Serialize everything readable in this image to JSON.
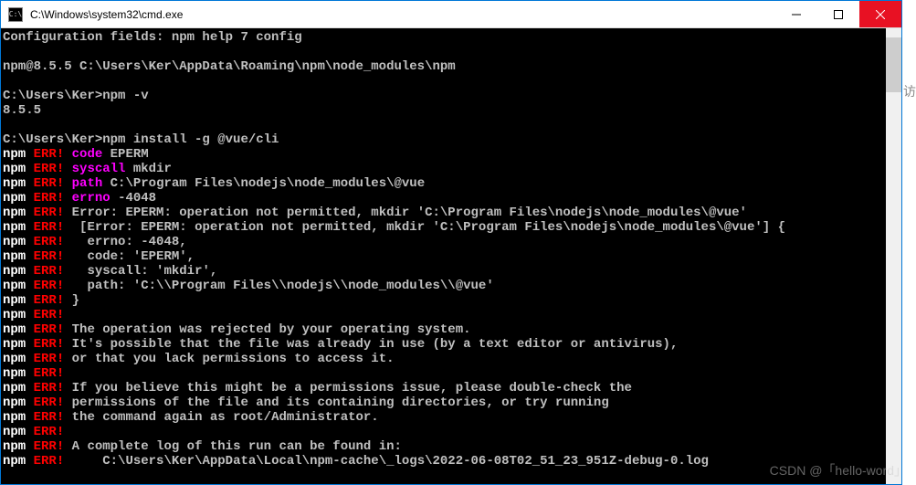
{
  "titlebar": {
    "icon_text": "C:\\",
    "title": "C:\\Windows\\system32\\cmd.exe"
  },
  "terminal": {
    "config_line": "Configuration fields: npm help 7 config",
    "npm_path": "npm@8.5.5 C:\\Users\\Ker\\AppData\\Roaming\\npm\\node_modules\\npm",
    "prompt1": "C:\\Users\\Ker>npm -v",
    "version": "8.5.5",
    "prompt2": "C:\\Users\\Ker>npm install -g @vue/cli",
    "err_lines": [
      {
        "label": "code",
        "value": "EPERM"
      },
      {
        "label": "syscall",
        "value": "mkdir"
      },
      {
        "label": "path",
        "value": "C:\\Program Files\\nodejs\\node_modules\\@vue"
      },
      {
        "label": "errno",
        "value": "-4048"
      }
    ],
    "err_msg_lines": [
      "Error: EPERM: operation not permitted, mkdir 'C:\\Program Files\\nodejs\\node_modules\\@vue'",
      " [Error: EPERM: operation not permitted, mkdir 'C:\\Program Files\\nodejs\\node_modules\\@vue'] {",
      "  errno: -4048,",
      "  code: 'EPERM',",
      "  syscall: 'mkdir',",
      "  path: 'C:\\\\Program Files\\\\nodejs\\\\node_modules\\\\@vue'",
      "}",
      "",
      "The operation was rejected by your operating system.",
      "It's possible that the file was already in use (by a text editor or antivirus),",
      "or that you lack permissions to access it.",
      "",
      "If you believe this might be a permissions issue, please double-check the",
      "permissions of the file and its containing directories, or try running",
      "the command again as root/Administrator.",
      "",
      "A complete log of this run can be found in:",
      "    C:\\Users\\Ker\\AppData\\Local\\npm-cache\\_logs\\2022-06-08T02_51_23_951Z-debug-0.log"
    ],
    "npm_prefix": "npm",
    "err_tag": "ERR!"
  },
  "watermark": "CSDN @「hello-word」",
  "side_char": "访"
}
